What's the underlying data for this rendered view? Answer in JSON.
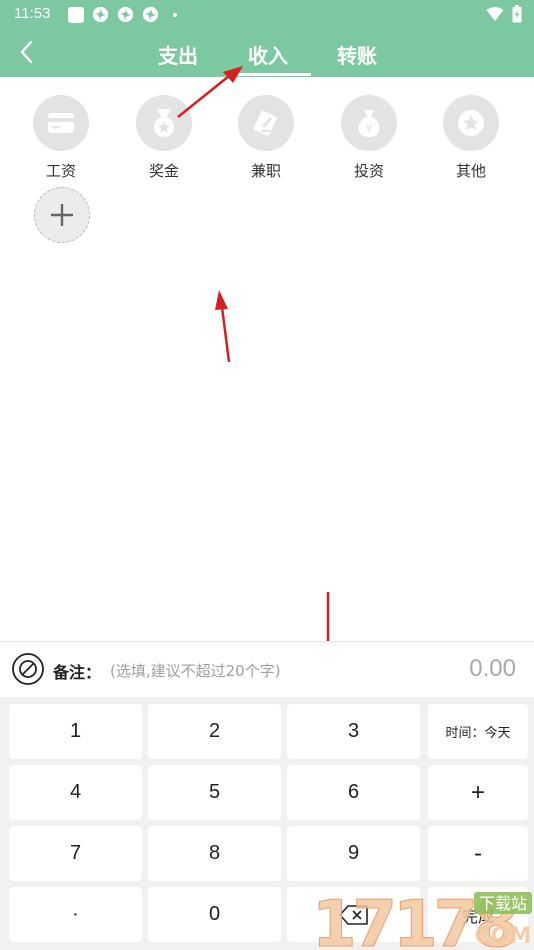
{
  "status_bar": {
    "time": "11:53",
    "icons": [
      "square-notification-icon",
      "pinwheel-icon",
      "pinwheel-icon",
      "pinwheel-icon",
      "dot-icon"
    ],
    "right_icons": [
      "wifi-icon",
      "battery-icon"
    ]
  },
  "header": {
    "tabs": [
      {
        "label": "支出",
        "active": false
      },
      {
        "label": "收入",
        "active": true
      },
      {
        "label": "转账",
        "active": false
      }
    ],
    "accent_color": "#7cc8a0"
  },
  "categories": [
    {
      "label": "工资",
      "icon": "card-icon"
    },
    {
      "label": "奖金",
      "icon": "medal-icon"
    },
    {
      "label": "兼职",
      "icon": "pen-icon"
    },
    {
      "label": "投资",
      "icon": "money-bag-icon"
    },
    {
      "label": "其他",
      "icon": "star-icon"
    }
  ],
  "add_category": {
    "icon": "plus-icon"
  },
  "note": {
    "label": "备注：",
    "placeholder": "(选填,建议不超过20个字)",
    "amount": "0.00"
  },
  "keypad": {
    "rows": [
      [
        "1",
        "2",
        "3",
        "时间：今天"
      ],
      [
        "4",
        "5",
        "6",
        "+"
      ],
      [
        "7",
        "8",
        "9",
        "-"
      ],
      [
        "·",
        "0",
        "",
        "完成"
      ]
    ]
  },
  "watermark": {
    "text": "17178",
    "sub_top": "下载站",
    "sub_bottom": "COM"
  }
}
